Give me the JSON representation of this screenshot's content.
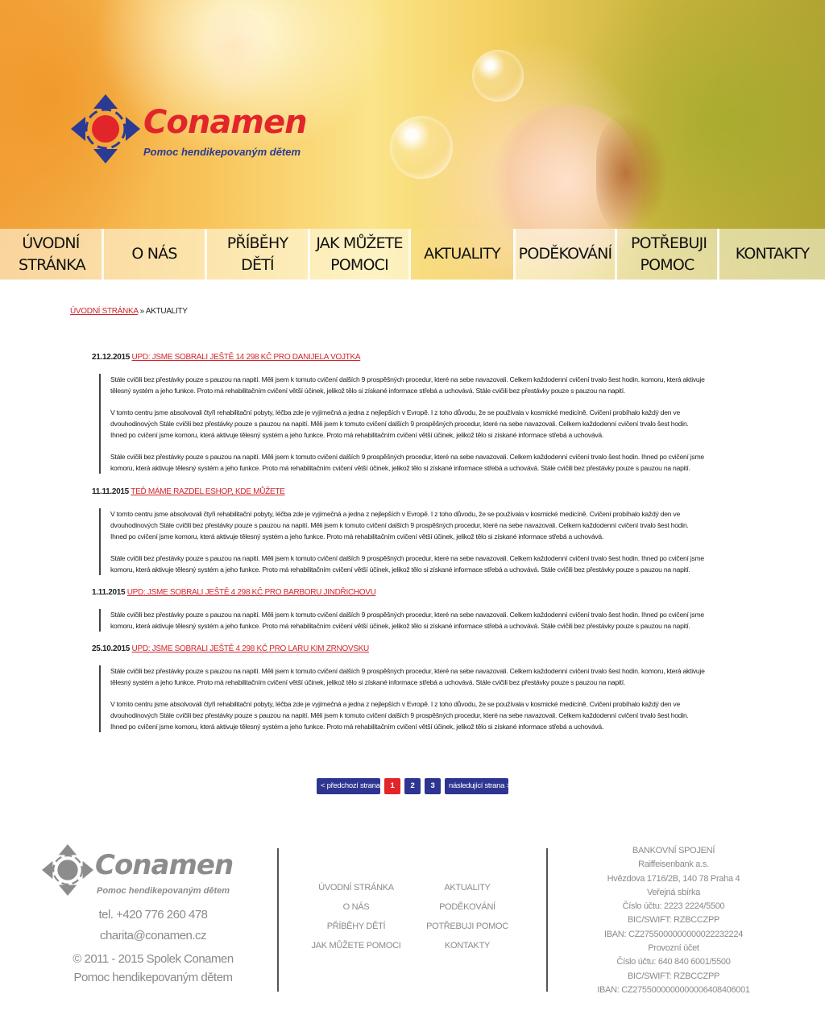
{
  "brand": {
    "name": "Conamen",
    "tagline": "Pomoc hendikepovaným dětem",
    "colors": {
      "red": "#e2252b",
      "blue": "#2b3a94",
      "grey": "#8c8c8c"
    }
  },
  "nav": {
    "items": [
      {
        "label": "ÚVODNÍ STRÁNKA",
        "active": false
      },
      {
        "label": "O NÁS",
        "active": false
      },
      {
        "label": "PŘÍBĚHY DĚTÍ",
        "active": false
      },
      {
        "label": "JAK MŮŽETE POMOCI",
        "active": false
      },
      {
        "label": "AKTUALITY",
        "active": true
      },
      {
        "label": "PODĚKOVÁNÍ",
        "active": false
      },
      {
        "label": "POTŘEBUJI POMOC",
        "active": false
      },
      {
        "label": "KONTAKTY",
        "active": false
      }
    ]
  },
  "breadcrumb": {
    "home": "ÚVODNÍ STRÁNKA",
    "separator": "»",
    "current": "AKTUALITY"
  },
  "news": [
    {
      "date": "21.12.2015",
      "title": "UPD: JSME SOBRALI JEŠTĚ 14 298 KČ PRO DANIJELA VOJTKA",
      "paragraphs": [
        "Stále cvičili bez přestávky pouze s pauzou na napití. Měli jsem k tomuto cvičení dalších 9 prospěšných procedur, které na sebe navazovali. Celkem každodenní cvičení trvalo šest hodin. komoru, která aktivuje tělesný systém a jeho funkce. Proto má rehabilitačním cvičení větší účinek, jelikož tělo si získané informace střebá a uchovává. Stále cvičili bez přestávky pouze s pauzou na napití.",
        "V tomto centru jsme absolvovali čtyři rehabilitační pobyty, léčba zde je vyjímečná a jedna z nejlepších v Evropě. I z toho důvodu, že se používala v kosmické medicíně. Cvičení probíhalo každý den ve dvouhodinových Stále cvičili bez přestávky pouze s pauzou na napití. Měli jsem k tomuto cvičení dalších 9 prospěšných procedur, které na sebe navazovali. Celkem každodenní cvičení trvalo šest hodin. Ihned po cvičení jsme komoru, která aktivuje tělesný systém a jeho funkce. Proto má rehabilitačním cvičení větší účinek, jelikož tělo si získané informace střebá a uchovává.",
        "Stále cvičili bez přestávky pouze s pauzou na napití. Měli jsem k tomuto cvičení dalších 9 prospěšných procedur, které na sebe navazovali. Celkem každodenní cvičení trvalo šest hodin. Ihned po cvičení jsme komoru, která aktivuje tělesný systém a jeho funkce. Proto má rehabilitačním cvičení větší účinek, jelikož tělo si získané informace střebá a uchovává. Stále cvičili bez přestávky pouze s pauzou na napití."
      ]
    },
    {
      "date": "11.11.2015",
      "title": "TEĎ MÁME RAZDEL ESHOP, KDE MŮŽETE",
      "paragraphs": [
        "V tomto centru jsme absolvovali čtyři rehabilitační pobyty, léčba zde je vyjímečná a jedna z nejlepších v Evropě. I z toho důvodu, že se používala v kosmické medicíně. Cvičení probíhalo každý den ve dvouhodinových Stále cvičili bez přestávky pouze s pauzou na napití. Měli jsem k tomuto cvičení dalších 9 prospěšných procedur, které na sebe navazovali. Celkem každodenní cvičení trvalo šest hodin. Ihned po cvičení jsme komoru, která aktivuje tělesný systém a jeho funkce. Proto má rehabilitačním cvičení větší účinek, jelikož tělo si získané informace střebá a uchovává.",
        "Stále cvičili bez přestávky pouze s pauzou na napití. Měli jsem k tomuto cvičení dalších 9 prospěšných procedur, které na sebe navazovali. Celkem každodenní cvičení trvalo šest hodin. Ihned po cvičení jsme komoru, která aktivuje tělesný systém a jeho funkce. Proto má rehabilitačním cvičení větší účinek, jelikož tělo si získané informace střebá a uchovává. Stále cvičili bez přestávky pouze s pauzou na napití."
      ]
    },
    {
      "date": "1.11.2015",
      "title": "UPD: JSME SOBRALI JEŠTĚ 4 298 KČ PRO BARBORU JINDŘICHOVU",
      "paragraphs": [
        "Stále cvičili bez přestávky pouze s pauzou na napití. Měli jsem k tomuto cvičení dalších 9 prospěšných procedur, které na sebe navazovali. Celkem každodenní cvičení trvalo šest hodin. Ihned po cvičení jsme komoru, která aktivuje tělesný systém a jeho funkce. Proto má rehabilitačním cvičení větší účinek, jelikož tělo si získané informace střebá a uchovává. Stále cvičili bez přestávky pouze s pauzou na napití."
      ]
    },
    {
      "date": "25.10.2015",
      "title": "UPD: JSME SOBRALI JEŠTĚ 4 298 KČ PRO LARU KIM ZRNOVSKU",
      "paragraphs": [
        "Stále cvičili bez přestávky pouze s pauzou na napití. Měli jsem k tomuto cvičení dalších 9 prospěšných procedur, které na sebe navazovali. Celkem každodenní cvičení trvalo šest hodin. komoru, která aktivuje tělesný systém a jeho funkce. Proto má rehabilitačním cvičení větší účinek, jelikož tělo si získané informace střebá a uchovává. Stále cvičili bez přestávky pouze s pauzou na napití.",
        "V tomto centru jsme absolvovali čtyři rehabilitační pobyty, léčba zde je vyjímečná a jedna z nejlepších v Evropě. I z toho důvodu, že se používala v kosmické medicíně. Cvičení probíhalo každý den ve dvouhodinových Stále cvičili bez přestávky pouze s pauzou na napití. Měli jsem k tomuto cvičení dalších 9 prospěšných procedur, které na sebe navazovali. Celkem každodenní cvičení trvalo šest hodin. Ihned po cvičení jsme komoru, která aktivuje tělesný systém a jeho funkce. Proto má rehabilitačním cvičení větší účinek, jelikož tělo si získané informace střebá a uchovává."
      ]
    }
  ],
  "pagination": {
    "prev_label": "< předchozí strana",
    "pages": [
      "1",
      "2",
      "3"
    ],
    "current_page": 1,
    "next_label": "následující strana >"
  },
  "footer": {
    "phone": "tel. +420 776 260 478",
    "email": "charita@conamen.cz",
    "copyright_line1": "© 2011 - 2015 Spolek Conamen",
    "copyright_line2": "Pomoc hendikepovaným dětem",
    "links_col1": [
      "ÚVODNÍ STRÁNKA",
      "O NÁS",
      "PŘÍBĚHY DĚTÍ",
      "JAK MŮŽETE POMOCI"
    ],
    "links_col2": [
      "AKTUALITY",
      "PODĚKOVÁNÍ",
      "POTŘEBUJI POMOC",
      "KONTAKTY"
    ],
    "bank_lines": [
      "BANKOVNÍ SPOJENÍ",
      "Raiffeisenbank a.s.",
      "Hvězdova 1716/2B, 140 78 Praha 4",
      "Veřejná sbírka",
      "Číslo účtu: 2223 2224/5500",
      "BIC/SWIFT: RZBCCZPP",
      "IBAN: CZ2755000000000022232224",
      "Provozní účet",
      "Číslo účtu: 640 840 6001/5500",
      "BIC/SWIFT: RZBCCZPP",
      "IBAN: CZ2755000000000006408406001"
    ]
  }
}
